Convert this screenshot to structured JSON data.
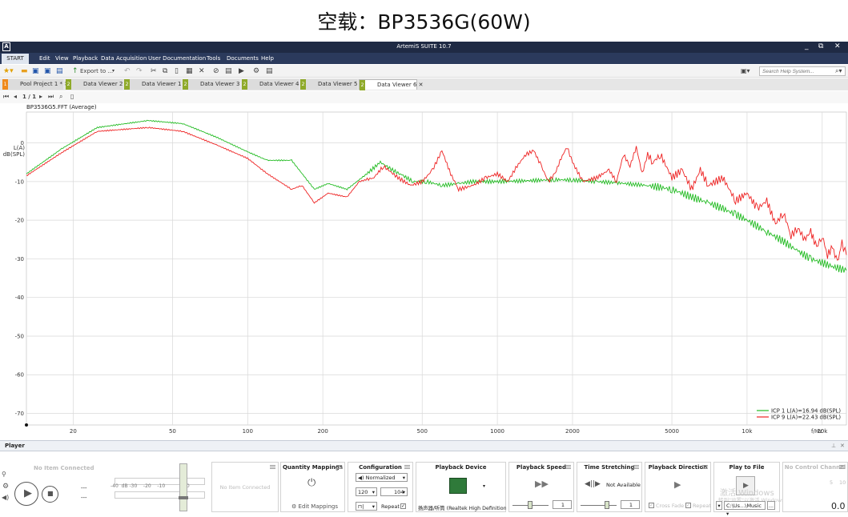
{
  "page_title": "空载：BP3536G(60W)",
  "app_title": "ArtemiS SUITE 10.7",
  "menu": [
    "START",
    "Edit",
    "View",
    "Playback",
    "Data Acquisition",
    "User Documentation",
    "Tools",
    "Documents",
    "Help"
  ],
  "toolbar": {
    "export_label": "Export to ...",
    "search_placeholder": "Search Help System..."
  },
  "tabs": [
    {
      "num": "1",
      "label": "Pool Project 1 *"
    },
    {
      "num": "2",
      "label": "Data Viewer 2"
    },
    {
      "num": "2",
      "label": "Data Viewer 1"
    },
    {
      "num": "2",
      "label": "Data Viewer 3"
    },
    {
      "num": "2",
      "label": "Data Viewer 4"
    },
    {
      "num": "2",
      "label": "Data Viewer 5"
    },
    {
      "num": "2",
      "label": "Data Viewer 6"
    }
  ],
  "nav": {
    "page": "1 / 1"
  },
  "plot_name": "BP3536G5.FFT (Average)",
  "colors": {
    "green": "#22bb22",
    "red": "#ee2222",
    "grid": "#d8d8d8",
    "chrome_dark": "#1f2a44",
    "tab_badge": "#8faa2a"
  },
  "chart_data": {
    "type": "line",
    "xscale": "log",
    "xlim": [
      13,
      25000
    ],
    "ylim": [
      -73,
      8
    ],
    "ylabel": [
      "L(A)",
      "dB(SPL)"
    ],
    "yticks": [
      0,
      -10,
      -20,
      -30,
      -40,
      -50,
      -60,
      -70
    ],
    "xticks": [
      {
        "v": 20,
        "l": "20"
      },
      {
        "v": 50,
        "l": "50"
      },
      {
        "v": 100,
        "l": "100"
      },
      {
        "v": 200,
        "l": "200"
      },
      {
        "v": 500,
        "l": "500"
      },
      {
        "v": 1000,
        "l": "1000"
      },
      {
        "v": 2000,
        "l": "2000"
      },
      {
        "v": 5000,
        "l": "5000"
      },
      {
        "v": 10000,
        "l": "10k"
      },
      {
        "v": 20000,
        "l": "20k"
      }
    ],
    "xunit": "f/Hz",
    "series": [
      {
        "name": "ICP 1 L(A)=16.94 dB(SPL)",
        "color": "#22bb22",
        "points": [
          [
            13,
            -8
          ],
          [
            18,
            -1.5
          ],
          [
            25,
            4
          ],
          [
            40,
            5.8
          ],
          [
            55,
            5
          ],
          [
            75,
            1.5
          ],
          [
            100,
            -2.3
          ],
          [
            120,
            -4.5
          ],
          [
            150,
            -4.5
          ],
          [
            185,
            -12
          ],
          [
            210,
            -10.5
          ],
          [
            250,
            -12
          ],
          [
            300,
            -8
          ],
          [
            340,
            -5
          ],
          [
            380,
            -7
          ],
          [
            420,
            -8.5
          ],
          [
            460,
            -10
          ],
          [
            520,
            -10
          ],
          [
            600,
            -11
          ],
          [
            700,
            -10.5
          ],
          [
            800,
            -10
          ],
          [
            1000,
            -10
          ],
          [
            1300,
            -9.8
          ],
          [
            1700,
            -9.5
          ],
          [
            2000,
            -9.6
          ],
          [
            2500,
            -10
          ],
          [
            3000,
            -10.3
          ],
          [
            3500,
            -10.7
          ],
          [
            4000,
            -11
          ],
          [
            5000,
            -12
          ],
          [
            6000,
            -14
          ],
          [
            7000,
            -15.5
          ],
          [
            8000,
            -17
          ],
          [
            9000,
            -18.5
          ],
          [
            10000,
            -20
          ],
          [
            12000,
            -23
          ],
          [
            14000,
            -25.5
          ],
          [
            16000,
            -28
          ],
          [
            18000,
            -30
          ],
          [
            20000,
            -31
          ],
          [
            22000,
            -32
          ],
          [
            25000,
            -33
          ]
        ]
      },
      {
        "name": "ICP 9 L(A)=22.43 dB(SPL)",
        "color": "#ee2222",
        "points": [
          [
            13,
            -8.5
          ],
          [
            18,
            -2.5
          ],
          [
            25,
            3
          ],
          [
            40,
            4
          ],
          [
            55,
            3
          ],
          [
            75,
            -0.5
          ],
          [
            100,
            -4
          ],
          [
            120,
            -8
          ],
          [
            150,
            -12
          ],
          [
            165,
            -11
          ],
          [
            185,
            -15.5
          ],
          [
            210,
            -13
          ],
          [
            250,
            -14
          ],
          [
            280,
            -10
          ],
          [
            320,
            -9
          ],
          [
            350,
            -6
          ],
          [
            400,
            -9
          ],
          [
            450,
            -11
          ],
          [
            500,
            -10
          ],
          [
            550,
            -7
          ],
          [
            600,
            -2
          ],
          [
            650,
            -8
          ],
          [
            700,
            -12
          ],
          [
            800,
            -11
          ],
          [
            900,
            -9
          ],
          [
            1000,
            -8
          ],
          [
            1100,
            -10
          ],
          [
            1200,
            -6
          ],
          [
            1300,
            -3
          ],
          [
            1400,
            -2
          ],
          [
            1500,
            -6
          ],
          [
            1600,
            -10
          ],
          [
            1700,
            -8
          ],
          [
            1800,
            -4
          ],
          [
            1900,
            -1
          ],
          [
            2000,
            -5
          ],
          [
            2200,
            -10
          ],
          [
            2500,
            -9
          ],
          [
            2800,
            -7
          ],
          [
            3000,
            -10
          ],
          [
            3200,
            -3
          ],
          [
            3400,
            -6
          ],
          [
            3600,
            -1
          ],
          [
            3800,
            -8
          ],
          [
            4000,
            -3
          ],
          [
            4200,
            -5
          ],
          [
            4500,
            -3
          ],
          [
            5000,
            -9
          ],
          [
            5500,
            -7
          ],
          [
            6000,
            -12
          ],
          [
            6500,
            -7
          ],
          [
            7000,
            -11
          ],
          [
            8000,
            -9
          ],
          [
            9000,
            -15
          ],
          [
            10000,
            -13
          ],
          [
            11000,
            -17
          ],
          [
            12000,
            -15
          ],
          [
            13000,
            -21
          ],
          [
            14000,
            -18
          ],
          [
            15000,
            -24
          ],
          [
            16000,
            -22
          ],
          [
            17000,
            -25
          ],
          [
            18000,
            -23
          ],
          [
            19000,
            -27
          ],
          [
            20000,
            -24
          ],
          [
            21000,
            -29
          ],
          [
            22000,
            -27
          ],
          [
            23000,
            -31
          ],
          [
            24000,
            -26
          ],
          [
            25000,
            -29
          ]
        ]
      }
    ]
  },
  "legend": [
    "ICP 1 L(A)=16.94 dB(SPL)",
    "ICP 9 L(A)=22.43 dB(SPL)"
  ],
  "player": {
    "header": "Player",
    "no_item": "No Item Connected",
    "no_item2": "No Item Connected",
    "dashes": [
      "---",
      "---"
    ],
    "level_ticks": [
      "-40",
      "dB -30",
      "-20",
      "-10",
      "10"
    ],
    "panels": {
      "quantity_mappings": {
        "title": "Quantity Mappings",
        "edit": "Edit Mappings"
      },
      "configuration": {
        "title": "Configuration",
        "mode": "Normalized",
        "a": "120",
        "b": "104",
        "repeat": "Repeat"
      },
      "playback_device": {
        "title": "Playback Device",
        "device": "扬声器/听筒 (Realtek High Definition"
      },
      "playback_speed": {
        "title": "Playback Speed",
        "value": "1"
      },
      "time_stretching": {
        "title": "Time Stretching",
        "status": "Not Available",
        "value": "1"
      },
      "playback_direction": {
        "title": "Playback Direction",
        "cross_fade": "Cross Fade",
        "repeat": "Repeat"
      },
      "play_to_file": {
        "title": "Play to File",
        "path": "C:\\Us...\\Music"
      },
      "no_control_channel": {
        "title": "No Control Channel",
        "value": "0.0",
        "s": "5",
        "t": "10"
      }
    },
    "watermark": [
      "激活 Windows",
      "转到\"设置\"以激活 Windows。"
    ]
  }
}
